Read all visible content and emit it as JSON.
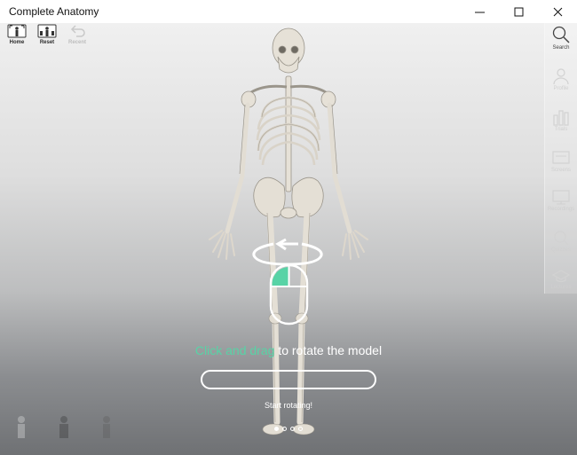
{
  "window": {
    "title": "Complete Anatomy"
  },
  "toolbar": {
    "items": [
      {
        "label": "Home",
        "icon": "home-figure-icon",
        "enabled": true
      },
      {
        "label": "Reset",
        "icon": "reset-figure-icon",
        "enabled": true
      },
      {
        "label": "Recent",
        "icon": "undo-arrow-icon",
        "enabled": false
      }
    ]
  },
  "sidebar": {
    "items": [
      {
        "label": "Search",
        "icon": "search-icon",
        "active": true
      },
      {
        "label": "Profile",
        "icon": "profile-icon",
        "active": false
      },
      {
        "label": "Trials",
        "icon": "trials-icon",
        "active": false
      },
      {
        "label": "Screens",
        "icon": "screens-icon",
        "active": false
      },
      {
        "label": "Recordings",
        "icon": "recordings-icon",
        "active": false
      },
      {
        "label": "Quizzes",
        "icon": "quiz-icon",
        "active": false
      },
      {
        "label": "Lectures",
        "icon": "lectures-icon",
        "active": false
      }
    ]
  },
  "tutorial": {
    "highlight": "Click and drag",
    "rest": " to rotate the model",
    "start_label": "Start rotating!",
    "progress": 0,
    "pages": 4,
    "current_page": 1
  },
  "colors": {
    "accent": "#58d3a6",
    "bone": "#e4dfd5",
    "overlay_text": "#ffffff"
  }
}
